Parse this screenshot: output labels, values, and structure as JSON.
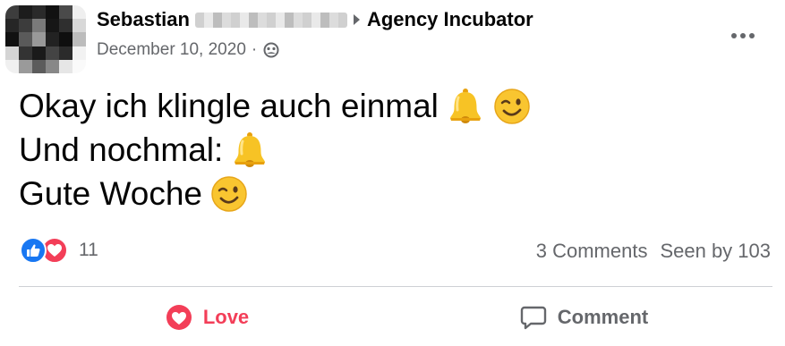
{
  "header": {
    "author_name": "Sebastian",
    "group_name": "Agency Incubator",
    "date": "December 10, 2020",
    "separator": "·",
    "audience_icon": "group-audience-icon",
    "more_icon": "more-options-icon"
  },
  "body": {
    "lines": [
      {
        "text": "Okay ich klingle auch einmal",
        "emojis": [
          "bell",
          "wink"
        ]
      },
      {
        "text": "Und nochmal:",
        "emojis": [
          "bell"
        ]
      },
      {
        "text": "Gute Woche",
        "emojis": [
          "wink"
        ]
      }
    ]
  },
  "stats": {
    "reaction_types": [
      "like",
      "love"
    ],
    "reaction_count": "11",
    "comments": "3 Comments",
    "seen_by": "Seen by 103"
  },
  "actions": {
    "love_label": "Love",
    "comment_label": "Comment"
  },
  "colors": {
    "love": "#f33e58",
    "like": "#1877f2",
    "secondary_text": "#65676b",
    "primary_text": "#050505",
    "divider": "#ced0d4"
  }
}
